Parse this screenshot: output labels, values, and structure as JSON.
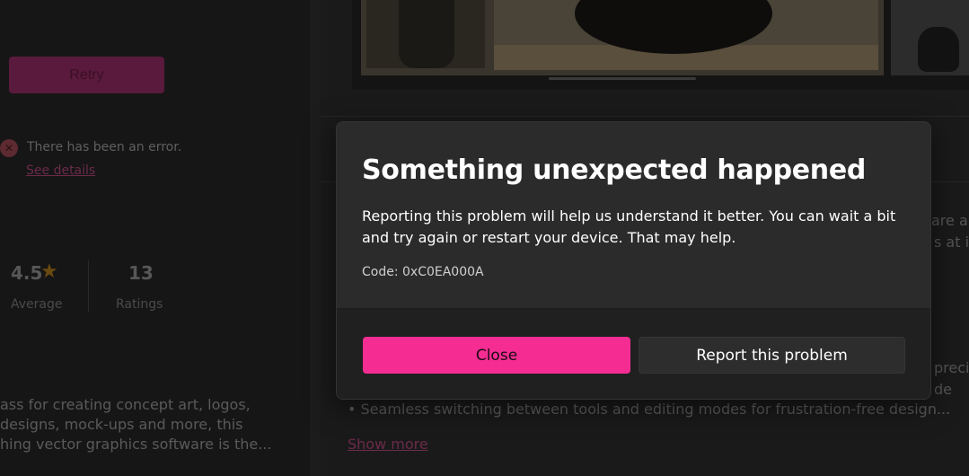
{
  "background": {
    "retry_label": "Retry",
    "error_text": "There has been an error.",
    "see_details": "See details",
    "rating": {
      "average_value": "4.5",
      "average_label": "Average",
      "ratings_count": "13",
      "ratings_label": "Ratings"
    },
    "description_left": [
      "ass for creating concept art, logos,",
      "designs, mock-ups and more, this",
      "hing vector graphics software is the..."
    ],
    "right_fragments": [
      "are ar",
      "s at its",
      "preci",
      "de"
    ],
    "bullet_line": "• Seamless switching between tools and editing modes for frustration-free design...",
    "show_more": "Show more"
  },
  "dialog": {
    "title": "Something unexpected happened",
    "body": "Reporting this problem will help us understand it better. You can wait a bit and try again or restart your device. That may help.",
    "code": "Code: 0xC0EA000A",
    "close_label": "Close",
    "report_label": "Report this problem"
  },
  "colors": {
    "accent": "#f52d93",
    "dialog_bg": "#2b2b2b",
    "footer_bg": "#202020"
  }
}
